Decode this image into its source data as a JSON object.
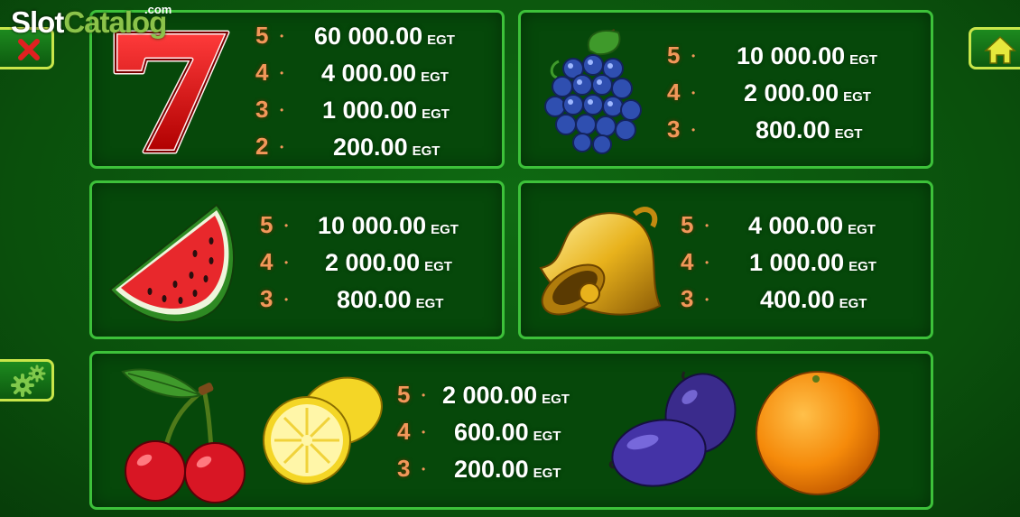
{
  "logo": {
    "part1": "Slot",
    "part2": "Catalog",
    "suffix": ".com"
  },
  "icons": {
    "close": "close-icon",
    "settings": "gear-icon",
    "home": "home-icon"
  },
  "colors": {
    "panel_border": "#3dc13a",
    "count": "#f2985a",
    "value": "#ffffff",
    "button_border": "#c8e64a"
  },
  "paytable": [
    {
      "symbol": "seven",
      "rows": [
        {
          "count": "5",
          "value": "60 000.00",
          "currency": "EGT"
        },
        {
          "count": "4",
          "value": "4 000.00",
          "currency": "EGT"
        },
        {
          "count": "3",
          "value": "1 000.00",
          "currency": "EGT"
        },
        {
          "count": "2",
          "value": "200.00",
          "currency": "EGT"
        }
      ]
    },
    {
      "symbol": "grapes",
      "rows": [
        {
          "count": "5",
          "value": "10 000.00",
          "currency": "EGT"
        },
        {
          "count": "4",
          "value": "2 000.00",
          "currency": "EGT"
        },
        {
          "count": "3",
          "value": "800.00",
          "currency": "EGT"
        }
      ]
    },
    {
      "symbol": "watermelon",
      "rows": [
        {
          "count": "5",
          "value": "10 000.00",
          "currency": "EGT"
        },
        {
          "count": "4",
          "value": "2 000.00",
          "currency": "EGT"
        },
        {
          "count": "3",
          "value": "800.00",
          "currency": "EGT"
        }
      ]
    },
    {
      "symbol": "bell",
      "rows": [
        {
          "count": "5",
          "value": "4 000.00",
          "currency": "EGT"
        },
        {
          "count": "4",
          "value": "1 000.00",
          "currency": "EGT"
        },
        {
          "count": "3",
          "value": "400.00",
          "currency": "EGT"
        }
      ]
    },
    {
      "symbol": "cherry-lemon-plum-orange",
      "rows": [
        {
          "count": "5",
          "value": "2 000.00",
          "currency": "EGT"
        },
        {
          "count": "4",
          "value": "600.00",
          "currency": "EGT"
        },
        {
          "count": "3",
          "value": "200.00",
          "currency": "EGT"
        }
      ]
    }
  ]
}
